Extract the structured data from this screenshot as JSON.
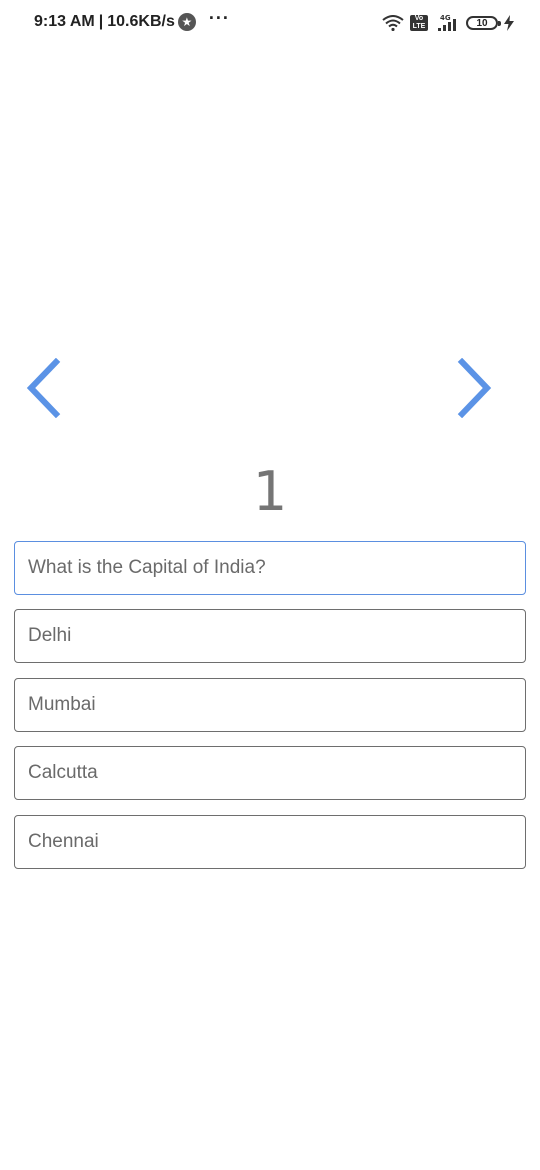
{
  "status_bar": {
    "time": "9:13 AM",
    "separator": "|",
    "network_speed": "10.6KB/s",
    "more": "···",
    "network_type": "4G",
    "volte": "Vo LTE",
    "battery_level": "10",
    "icons": [
      "star-icon",
      "more-icon",
      "wifi-icon",
      "volte-icon",
      "signal-icon",
      "battery-icon",
      "charging-icon"
    ]
  },
  "quiz": {
    "question_number": "1",
    "question": "What is the Capital of India?",
    "options": [
      "Delhi",
      "Mumbai",
      "Calcutta",
      "Chennai"
    ]
  },
  "navigation": {
    "prev_icon": "chevron-left-icon",
    "next_icon": "chevron-right-icon"
  },
  "colors": {
    "accent": "#5b8fe0",
    "arrow": "#5b93e6",
    "text_gray": "#6a6a6a",
    "number_gray": "#757575",
    "border": "#6e6e6e"
  }
}
